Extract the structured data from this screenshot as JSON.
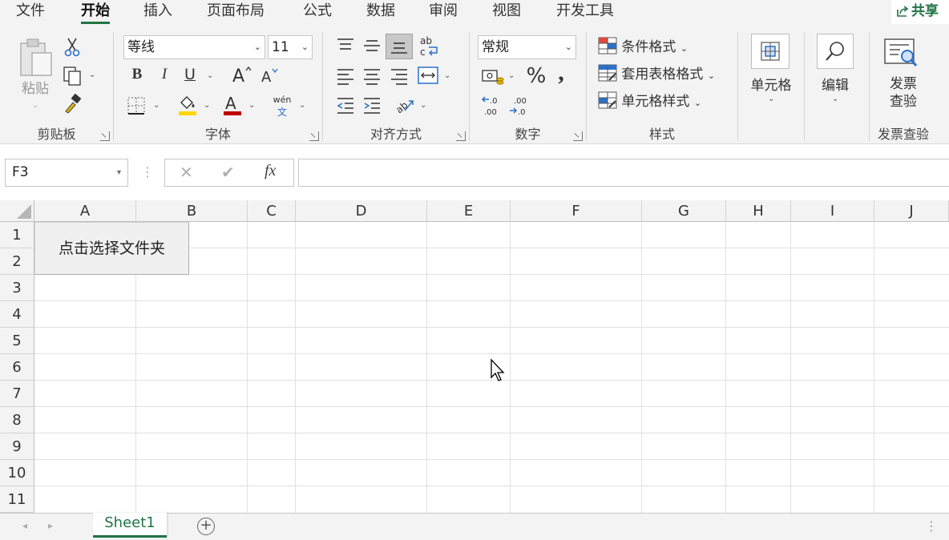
{
  "menu": {
    "tabs": [
      "文件",
      "开始",
      "插入",
      "页面布局",
      "公式",
      "数据",
      "审阅",
      "视图",
      "开发工具"
    ],
    "active": "开始",
    "share_label": "共享"
  },
  "ribbon": {
    "clipboard": {
      "paste_label": "粘贴",
      "group_label": "剪贴板"
    },
    "font": {
      "font_name": "等线",
      "font_size": "11",
      "bold": "B",
      "italic": "I",
      "underline": "U",
      "phonetic_top": "wén",
      "phonetic_bottom": "文",
      "group_label": "字体"
    },
    "alignment": {
      "group_label": "对齐方式"
    },
    "number": {
      "format": "常规",
      "percent": "%",
      "comma": ",",
      "group_label": "数字"
    },
    "styles": {
      "conditional_format": "条件格式",
      "table_format": "套用表格格式",
      "cell_styles": "单元格样式",
      "group_label": "样式"
    },
    "cells": {
      "label": "单元格"
    },
    "editing": {
      "label": "编辑"
    },
    "invoice": {
      "button_line1": "发票",
      "button_line2": "查验",
      "group_label": "发票查验"
    }
  },
  "formula_bar": {
    "name_box": "F3",
    "cancel": "✕",
    "enter": "✔",
    "fx": "fx",
    "value": ""
  },
  "grid": {
    "columns": [
      "A",
      "B",
      "C",
      "D",
      "E",
      "F",
      "G",
      "H",
      "I",
      "J"
    ],
    "rows": [
      "1",
      "2",
      "3",
      "4",
      "5",
      "6",
      "7",
      "8",
      "9",
      "10",
      "11"
    ],
    "button_label": "点击选择文件夹"
  },
  "sheets": {
    "tabs": [
      "Sheet1"
    ],
    "active": "Sheet1"
  },
  "colors": {
    "accent": "#217346",
    "font_color_bar": "#c00000",
    "fill_color_bar": "#ffd700"
  }
}
